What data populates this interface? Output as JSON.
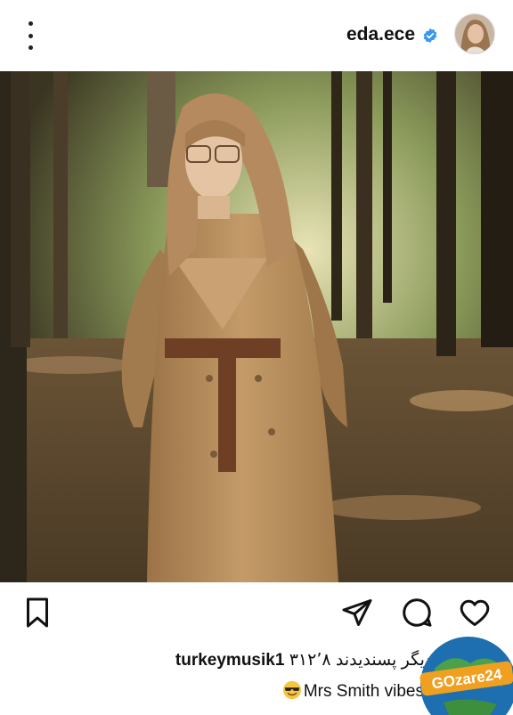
{
  "post": {
    "username": "eda.ece",
    "liked_by_user": "turkeymusik1",
    "likes_text": "۳۱۲٬۸ نفر دیگر پسندیدند",
    "caption": "Mrs Smith vibes"
  },
  "watermark": {
    "text": "GOzare24"
  },
  "icons": [
    "more-icon",
    "verified-icon",
    "bookmark-icon",
    "share-icon",
    "comment-icon",
    "heart-icon"
  ],
  "colors": {
    "verified": "#3897f0",
    "text": "#111111",
    "coat": "#b98d5c"
  }
}
